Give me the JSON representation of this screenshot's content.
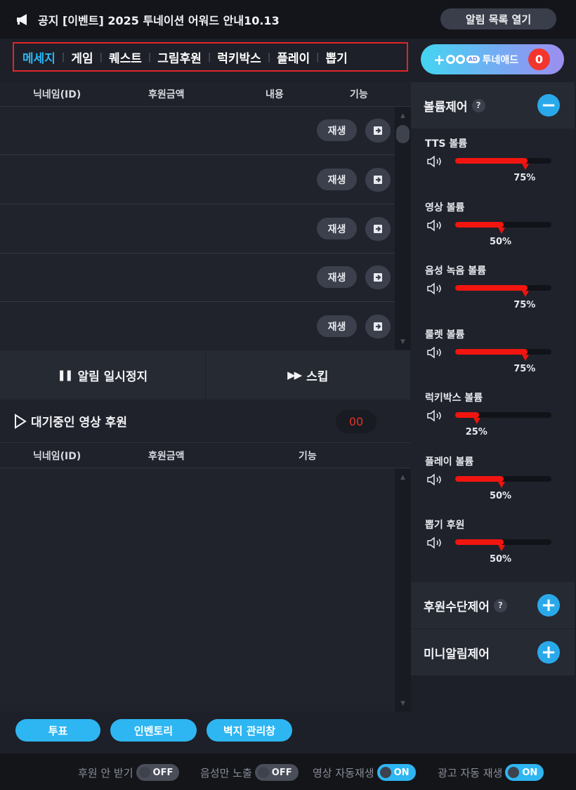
{
  "notice": {
    "text": "공지 [이벤트] 2025 투네이션 어워드 안내10.13",
    "icon": "megaphone-icon"
  },
  "alarm_list_button": "알림 목록 열기",
  "tabs": [
    {
      "label": "메세지",
      "active": true
    },
    {
      "label": "게임",
      "active": false
    },
    {
      "label": "퀘스트",
      "active": false
    },
    {
      "label": "그림후원",
      "active": false
    },
    {
      "label": "럭키박스",
      "active": false
    },
    {
      "label": "플레이",
      "active": false
    },
    {
      "label": "뽑기",
      "active": false
    }
  ],
  "tuneaid": {
    "label": "투네애드",
    "ad_badge": "AD",
    "count": "0"
  },
  "message_table": {
    "headers": {
      "nickname": "닉네임(ID)",
      "amount": "후원금액",
      "content": "내용",
      "function": "기능"
    },
    "rows": [
      {
        "play": "재생"
      },
      {
        "play": "재생"
      },
      {
        "play": "재생"
      },
      {
        "play": "재생"
      },
      {
        "play": "재생"
      }
    ]
  },
  "controls": {
    "pause": "알림 일시정지",
    "skip": "스킵"
  },
  "waiting_video": {
    "title": "대기중인 영상 후원",
    "count": "00"
  },
  "waiting_table": {
    "headers": {
      "nickname": "닉네임(ID)",
      "amount": "후원금액",
      "function": "기능"
    }
  },
  "volume_control": {
    "title": "볼륨제어",
    "help": "?",
    "items": [
      {
        "name": "TTS 볼륨",
        "value": 75,
        "label": "75%"
      },
      {
        "name": "영상 볼륨",
        "value": 50,
        "label": "50%"
      },
      {
        "name": "음성 녹음 볼륨",
        "value": 75,
        "label": "75%"
      },
      {
        "name": "룰렛 볼륨",
        "value": 75,
        "label": "75%"
      },
      {
        "name": "럭키박스 볼륨",
        "value": 25,
        "label": "25%"
      },
      {
        "name": "플레이 볼륨",
        "value": 50,
        "label": "50%"
      },
      {
        "name": "뽑기 후원",
        "value": 50,
        "label": "50%"
      }
    ]
  },
  "donation_method_control": {
    "title": "후원수단제어",
    "help": "?"
  },
  "mini_alarm_control": {
    "title": "미니알림제어"
  },
  "bottom_buttons": {
    "vote": "투표",
    "inventory": "인벤토리",
    "wall_manager": "벽지 관리창"
  },
  "footer": [
    {
      "label": "후원 안 받기",
      "state": "OFF"
    },
    {
      "label": "음성만 노출",
      "state": "OFF"
    },
    {
      "label": "영상 자동재생",
      "state": "ON"
    },
    {
      "label": "광고 자동 재생",
      "state": "ON"
    }
  ],
  "colors": {
    "accent": "#2eb6f2",
    "active_tab": "#29b6f6",
    "volume_fill": "#f2150f",
    "tab_border": "#e0262b",
    "badge_red": "#f2362d"
  }
}
